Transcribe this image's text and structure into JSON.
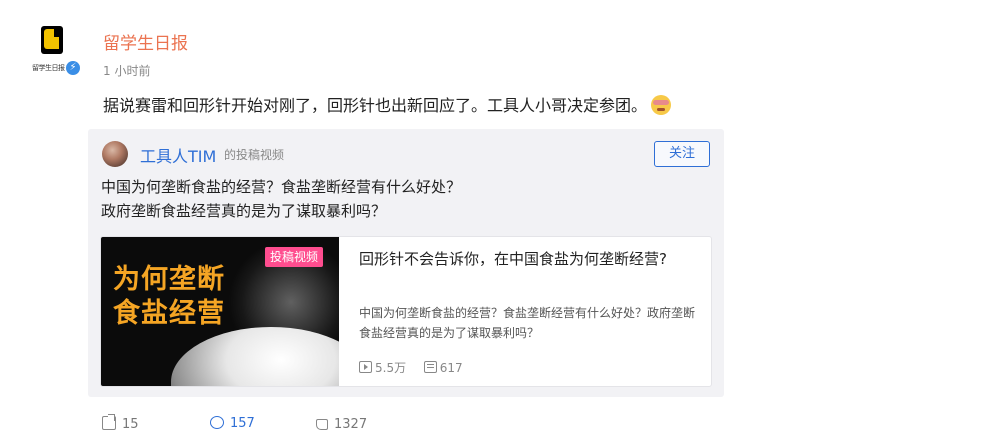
{
  "post": {
    "author": {
      "name": "留学生日报",
      "brand_text": "留学生日报",
      "verified_icon": "verified-badge-icon"
    },
    "time": "1 小时前",
    "text": "据说赛雷和回形针开始对刚了，回形针也出新回应了。工具人小哥决定参团。",
    "emoji": "thinking-face-emoji"
  },
  "repost": {
    "author_name": "工具人TIM",
    "source_label": "的投稿视频",
    "follow_label": "关注",
    "lines": [
      "中国为何垄断食盐的经营？食盐垄断经营有什么好处？",
      "政府垄断食盐经营真的是为了谋取暴利吗？"
    ],
    "video_card": {
      "thumbnail_title_1": "为何垄断",
      "thumbnail_title_2": "食盐经营",
      "tag": "投稿视频",
      "title": "回形针不会告诉你，在中国食盐为何垄断经营?",
      "description": "中国为何垄断食盐的经营？食盐垄断经营有什么好处？政府垄断食盐经营真的是为了谋取暴利吗？",
      "plays": "5.5万",
      "danmaku": "617"
    }
  },
  "actions": {
    "forward_count": "15",
    "comment_count": "157",
    "like_count": "1327"
  },
  "colors": {
    "author_name": "#eb7350",
    "link_blue": "#2f6fd6",
    "tag_pink": "#ff4d8f",
    "thumb_title": "#f5a524"
  }
}
